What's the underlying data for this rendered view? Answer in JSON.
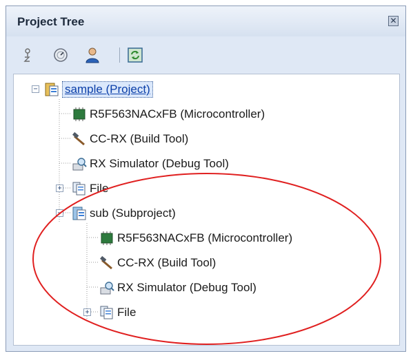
{
  "panel": {
    "title": "Project Tree",
    "close_icon": "close-icon"
  },
  "toolbar": {
    "buttons": [
      {
        "name": "sort-icon"
      },
      {
        "name": "property-icon"
      },
      {
        "name": "user-icon"
      },
      {
        "name": "refresh-icon"
      }
    ]
  },
  "tree": {
    "nodes": [
      {
        "label": "sample (Project)",
        "icon": "project-icon",
        "selected": true
      },
      {
        "label": "R5F563NACxFB (Microcontroller)",
        "icon": "microcontroller-icon"
      },
      {
        "label": "CC-RX (Build Tool)",
        "icon": "build-tool-icon"
      },
      {
        "label": "RX Simulator (Debug Tool)",
        "icon": "debug-tool-icon"
      },
      {
        "label": "File",
        "icon": "file-icon"
      },
      {
        "label": "sub (Subproject)",
        "icon": "subproject-icon"
      },
      {
        "label": "R5F563NACxFB (Microcontroller)",
        "icon": "microcontroller-icon"
      },
      {
        "label": "CC-RX (Build Tool)",
        "icon": "build-tool-icon"
      },
      {
        "label": "RX Simulator (Debug Tool)",
        "icon": "debug-tool-icon"
      },
      {
        "label": "File",
        "icon": "file-icon"
      }
    ]
  },
  "annotation": {
    "color": "#e02020"
  }
}
